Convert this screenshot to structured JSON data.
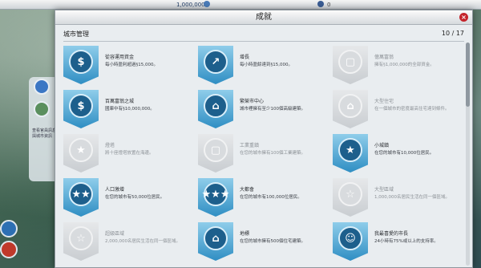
{
  "topbar": {
    "money": "1,000,000",
    "population": "0"
  },
  "side": {
    "text": "查看官員訊息與城市資訊"
  },
  "modal": {
    "title": "成就",
    "close": "×",
    "section": "城市管理",
    "count": "10 / 17"
  },
  "achievements": [
    {
      "icon": "$",
      "title": "從容運用資金",
      "desc": "每小時盈利超過§15,000。",
      "earned": true
    },
    {
      "icon": "↗",
      "title": "增長",
      "desc": "每小時盈餘達到§15,000。",
      "earned": true
    },
    {
      "icon": "▢",
      "title": "億萬富翁",
      "desc": "擁有§1,000,000的全部資金。",
      "earned": false
    },
    {
      "icon": "$",
      "title": "百萬富翁之城",
      "desc": "國庫中有§10,000,000。",
      "earned": true
    },
    {
      "icon": "⌂",
      "title": "繁榮市中心",
      "desc": "城市裡擁有至少100個高級建築。",
      "earned": true
    },
    {
      "icon": "⌂",
      "title": "大型住宅",
      "desc": "在一個城市的密度最高住宅達到條件。",
      "earned": false
    },
    {
      "icon": "★",
      "title": "燈塔",
      "desc": "將十座燈塔放置在海邊。",
      "earned": false
    },
    {
      "icon": "▢",
      "title": "工業重鎮",
      "desc": "在您的城市擁有100個工業建築。",
      "earned": false
    },
    {
      "icon": "★",
      "title": "小城鎮",
      "desc": "在您的城市有10,000位居民。",
      "earned": true
    },
    {
      "icon": "★★",
      "title": "人口激增",
      "desc": "在您的城市有50,000位居民。",
      "earned": true
    },
    {
      "icon": "★★★",
      "title": "大都會",
      "desc": "在您的城市有100,000位居民。",
      "earned": true
    },
    {
      "icon": "☆",
      "title": "大型區域",
      "desc": "1,000,000名居民生活在同一個區域。",
      "earned": false
    },
    {
      "icon": "☆",
      "title": "超級區域",
      "desc": "2,000,000名居民生活在同一個區域。",
      "earned": false
    },
    {
      "icon": "⌂",
      "title": "地標",
      "desc": "在您的城市擁有500個住宅建築。",
      "earned": true
    },
    {
      "icon": "☺",
      "title": "我最喜愛的市長",
      "desc": "24小時有75%或以上的支持率。",
      "earned": true
    }
  ]
}
